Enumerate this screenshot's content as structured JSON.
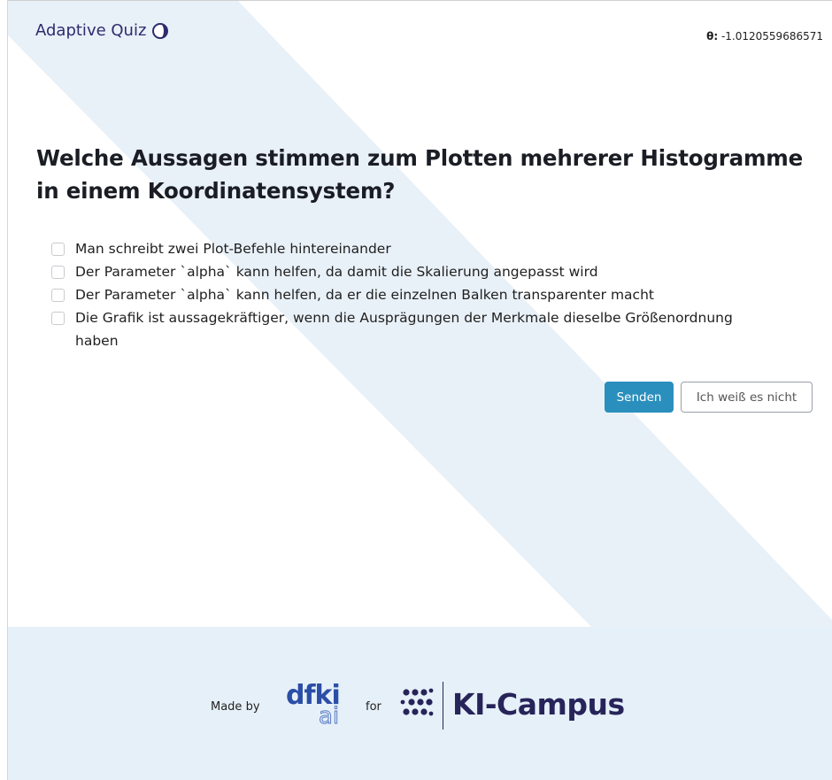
{
  "header": {
    "title": "Adaptive Quiz",
    "logo_icon": "half-moon-icon",
    "theta_label": "θ:",
    "theta_value": "-1.0120559686571"
  },
  "question": {
    "text": "Welche Aussagen stimmen zum Plotten mehrerer Histogramme in einem Koordinatensystem?",
    "options": [
      {
        "label": "Man schreibt zwei Plot-Befehle hintereinander",
        "checked": false
      },
      {
        "label": "Der Parameter `alpha` kann helfen, da damit die Skalierung angepasst wird",
        "checked": false
      },
      {
        "label": "Der Parameter `alpha` kann helfen, da er die einzelnen Balken transparenter macht",
        "checked": false
      },
      {
        "label": "Die Grafik ist aussagekräftiger, wenn die Ausprägungen der Merkmale dieselbe Größenordnung haben",
        "checked": false
      }
    ]
  },
  "actions": {
    "submit_label": "Senden",
    "dont_know_label": "Ich weiß es nicht"
  },
  "footer": {
    "made_by": "Made by",
    "dfki_top": "dfki",
    "dfki_bottom": "ai",
    "for": "for",
    "partner": "KI-Campus"
  },
  "colors": {
    "primary": "#2b8fbd",
    "brand": "#2f2b6e",
    "footer_bg": "#e6f0f8",
    "diagonal": "#e8f0f7"
  }
}
